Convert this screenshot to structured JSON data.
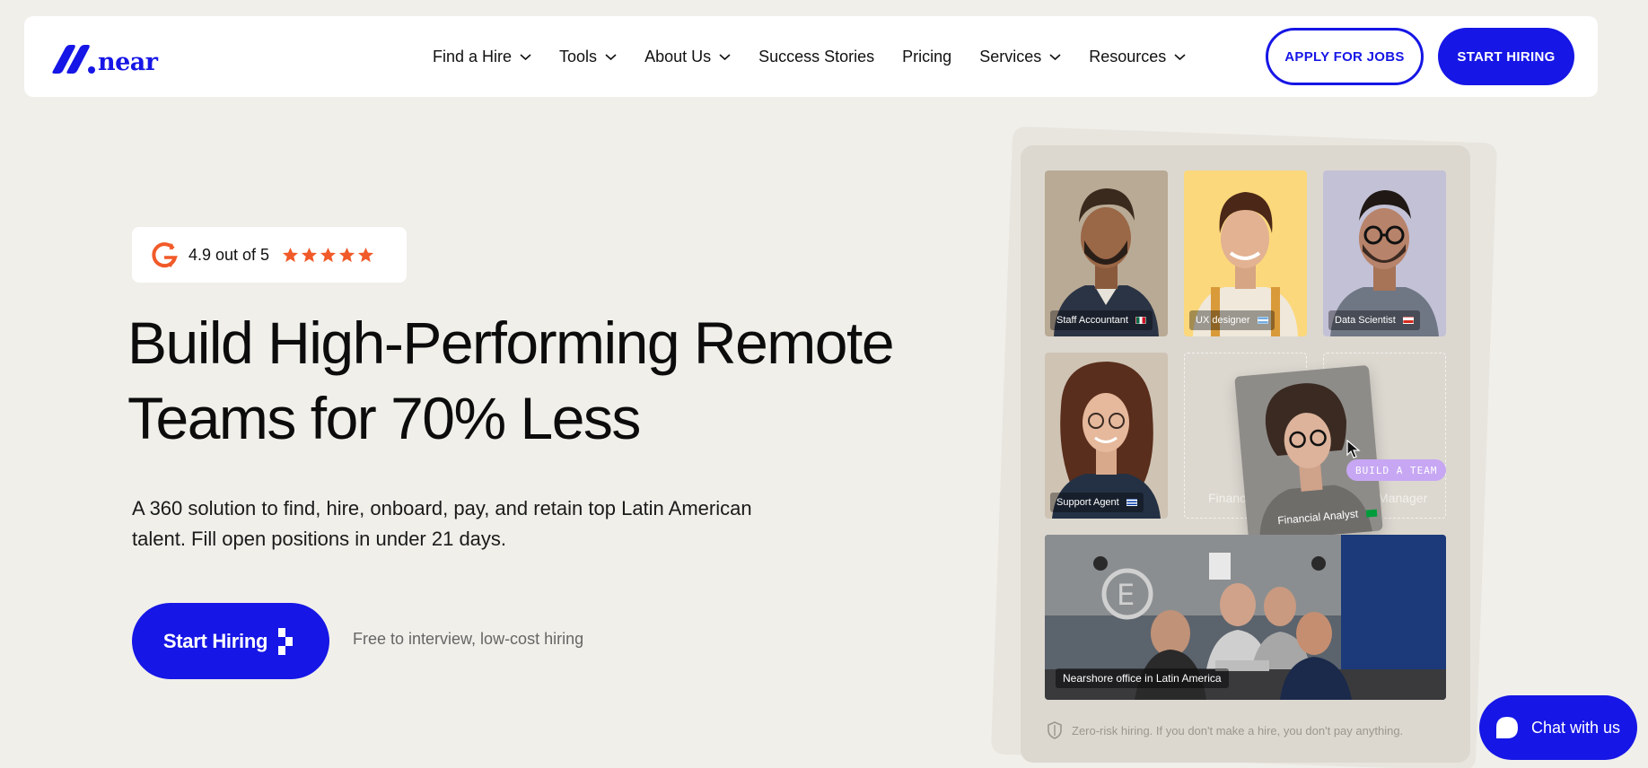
{
  "brand": {
    "name": "near",
    "color": "#1616e6"
  },
  "nav": {
    "items": [
      {
        "label": "Find a Hire",
        "dropdown": true
      },
      {
        "label": "Tools",
        "dropdown": true
      },
      {
        "label": "About Us",
        "dropdown": true
      },
      {
        "label": "Success Stories",
        "dropdown": false
      },
      {
        "label": "Pricing",
        "dropdown": false
      },
      {
        "label": "Services",
        "dropdown": true
      },
      {
        "label": "Resources",
        "dropdown": true
      }
    ],
    "apply_label": "APPLY FOR JOBS",
    "start_label": "START HIRING"
  },
  "rating": {
    "text": "4.9 out of 5",
    "stars": 5,
    "star_color": "#f15a29"
  },
  "hero": {
    "headline_line1": "Build High-Performing Remote",
    "headline_line2": "Teams for 70% Less",
    "subtext_line1": "A 360 solution to find, hire, onboard, pay, and retain top Latin American",
    "subtext_line2": "talent. Fill open positions in under 21 days.",
    "cta_label": "Start Hiring",
    "cta_note": "Free to interview, low-cost hiring"
  },
  "panel": {
    "cards": [
      {
        "role": "Staff Accountant",
        "flag": "mexico-flag-icon"
      },
      {
        "role": "UX designer",
        "flag": "argentina-flag-icon"
      },
      {
        "role": "Data Scientist",
        "flag": "chile-flag-icon"
      },
      {
        "role": "Support Agent",
        "flag": "uruguay-flag-icon"
      }
    ],
    "placeholders": [
      "Financial",
      "Manager"
    ],
    "drag_card_role": "Financial Analyst",
    "drag_card_flag": "brazil-flag-icon",
    "build_badge": "BUILD A TEAM",
    "office_caption": "Nearshore office in Latin America",
    "zero_risk": "Zero-risk hiring. If you don't make a hire, you don't pay anything."
  },
  "chat": {
    "label": "Chat with us"
  }
}
